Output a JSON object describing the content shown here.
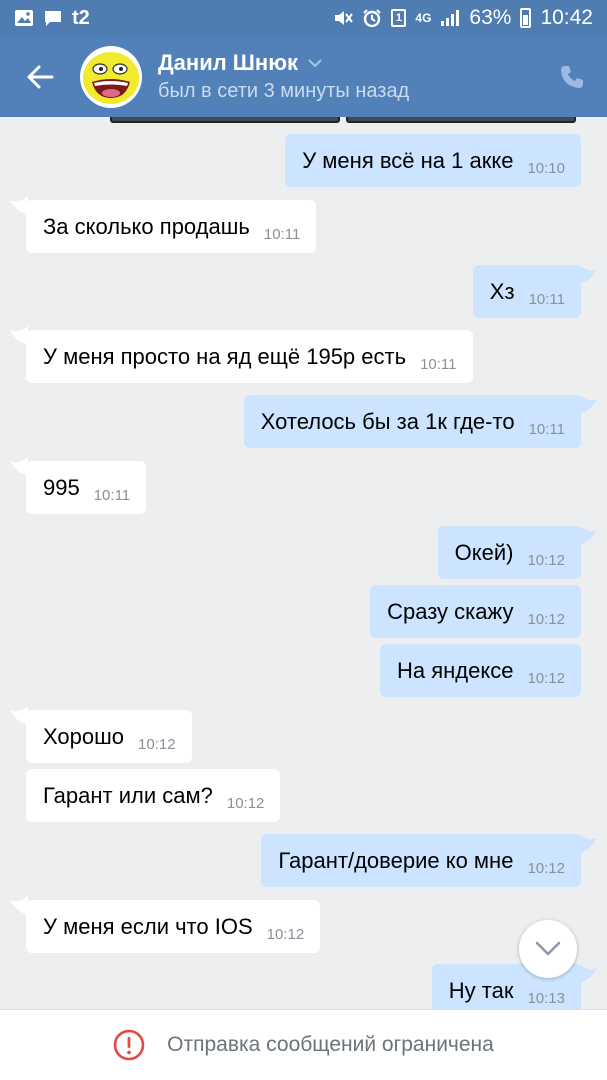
{
  "status_bar": {
    "carrier": "t2",
    "sim_slot": "1",
    "network": "4G",
    "battery_percent": "63%",
    "time": "10:42",
    "icons": [
      "image-icon",
      "chat-icon",
      "mute-icon",
      "alarm-icon",
      "signal-icon",
      "battery-icon"
    ]
  },
  "header": {
    "contact_name": "Данил Шнюк",
    "contact_status": "был в сети 3 минуты назад",
    "icons": [
      "back-arrow-icon",
      "chevron-down-icon",
      "phone-icon"
    ],
    "colors": {
      "header_bg": "#5181b8",
      "status_bg": "#4f7db1"
    }
  },
  "messages": [
    {
      "dir": "out",
      "text": "У меня всё на 1 акке",
      "time": "10:10"
    },
    {
      "dir": "in",
      "text": "За сколько продашь",
      "time": "10:11"
    },
    {
      "dir": "out",
      "text": "Хз",
      "time": "10:11"
    },
    {
      "dir": "in",
      "text": "У меня просто на яд ещё 195р есть",
      "time": "10:11"
    },
    {
      "dir": "out",
      "text": "Хотелось бы за 1к где-то",
      "time": "10:11"
    },
    {
      "dir": "in",
      "text": "995",
      "time": "10:11"
    },
    {
      "dir": "out",
      "text": "Окей)",
      "time": "10:12"
    },
    {
      "dir": "out",
      "text": "Сразу скажу",
      "time": "10:12"
    },
    {
      "dir": "out",
      "text": "На яндексе",
      "time": "10:12"
    },
    {
      "dir": "in",
      "text": "Хорошо",
      "time": "10:12"
    },
    {
      "dir": "in",
      "text": "Гарант или сам?",
      "time": "10:12"
    },
    {
      "dir": "out",
      "text": "Гарант/доверие ко мне",
      "time": "10:12"
    },
    {
      "dir": "in",
      "text": "У меня если что IOS",
      "time": "10:12"
    },
    {
      "dir": "out",
      "text": "Ну так",
      "time": "10:13"
    }
  ],
  "bottom_bar": {
    "text": "Отправка сообщений ограничена",
    "icon": "alert-circle-icon",
    "accent": "#e64646"
  },
  "colors": {
    "bubble_in": "#ffffff",
    "bubble_out": "#cce4ff",
    "chat_bg": "#edeef0"
  }
}
